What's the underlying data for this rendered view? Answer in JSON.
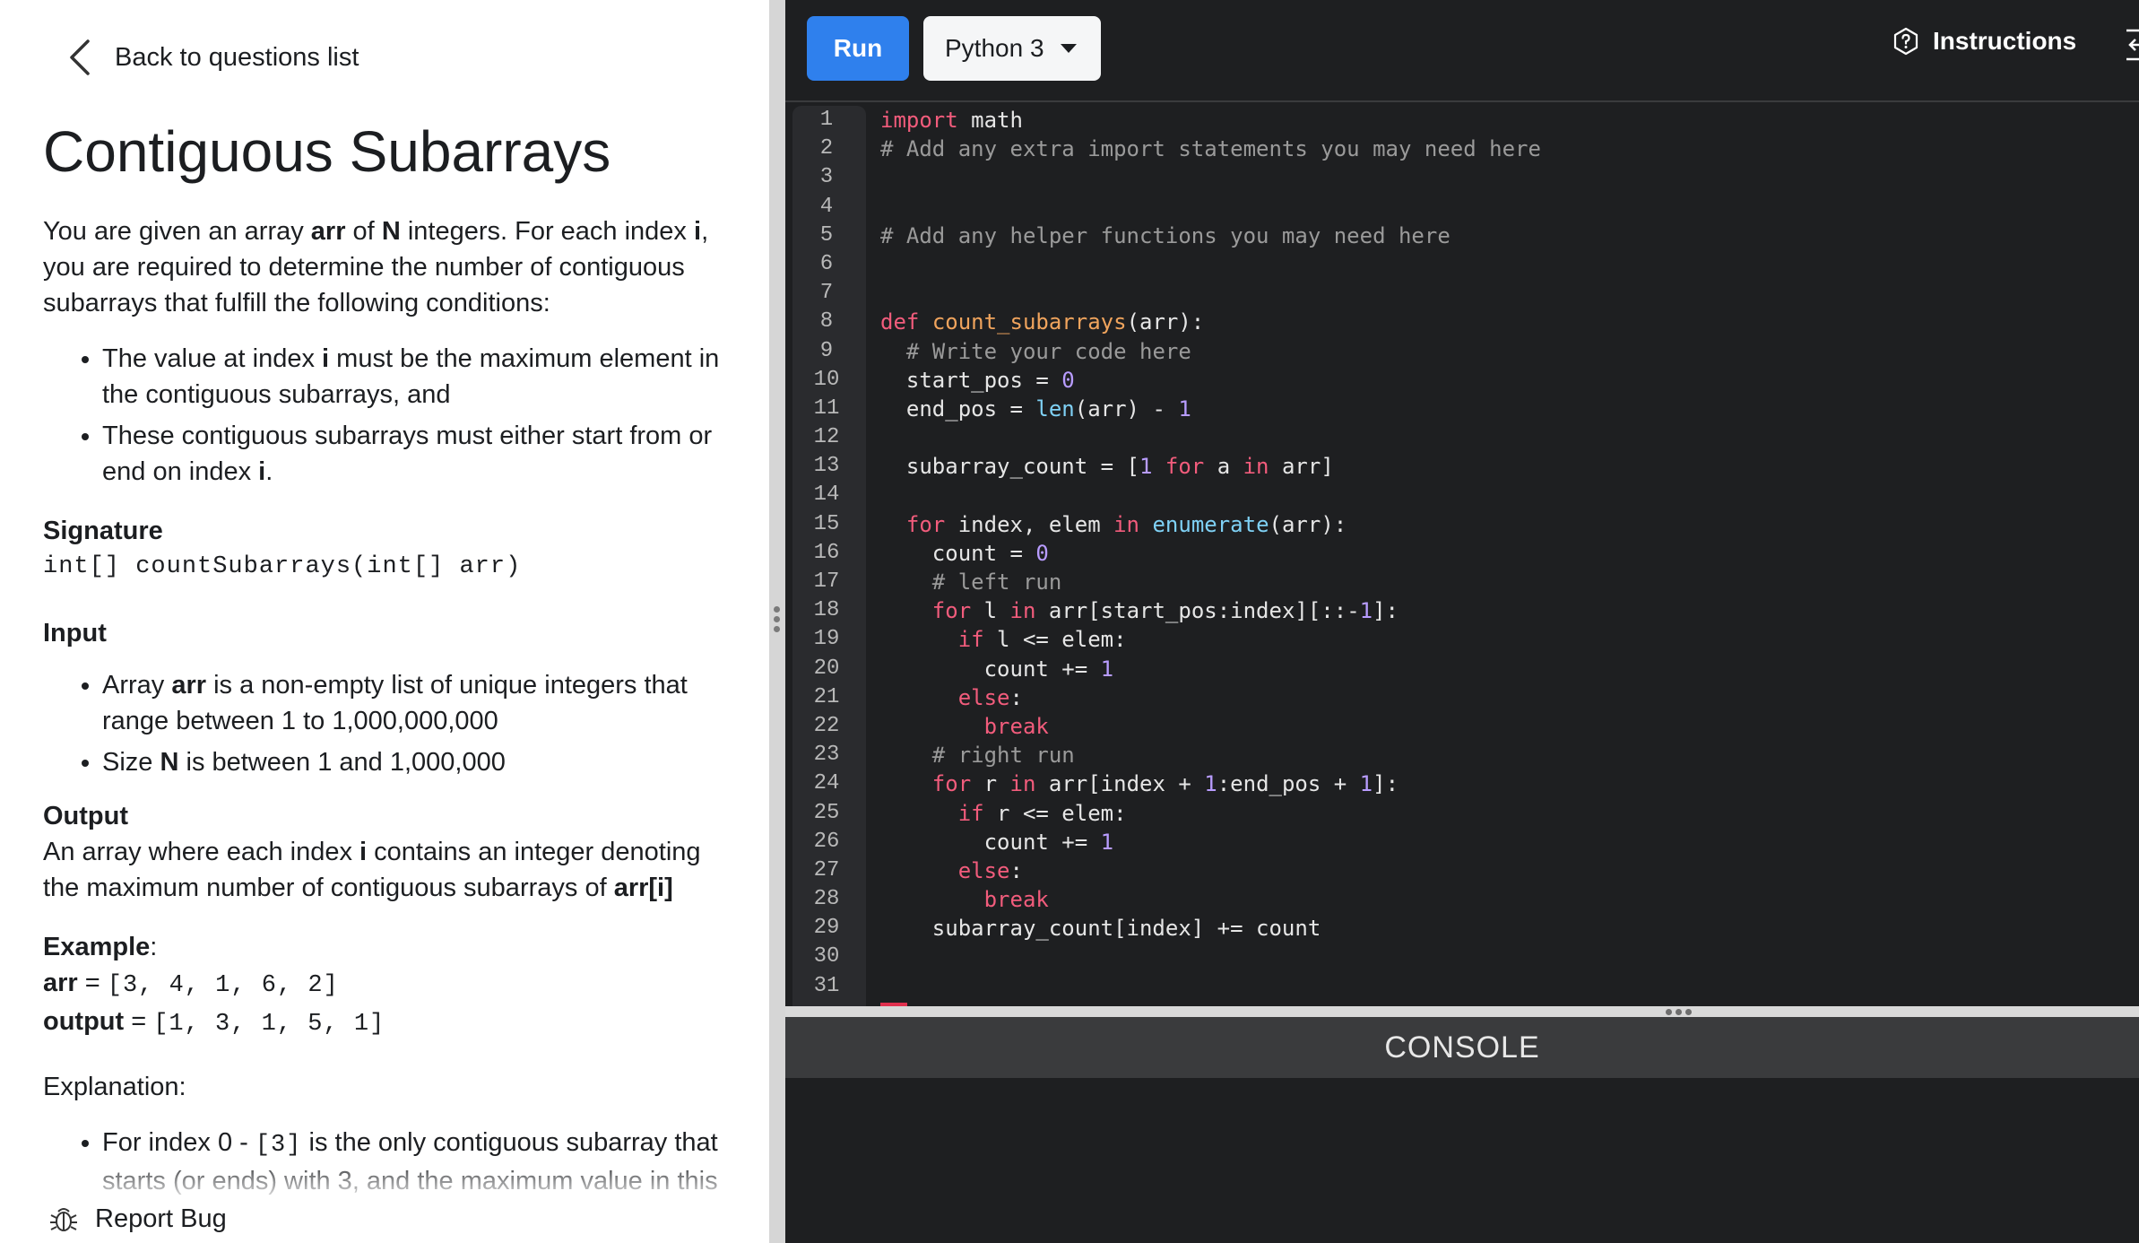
{
  "nav": {
    "back_label": "Back to questions list"
  },
  "problem": {
    "title": "Contiguous Subarrays",
    "intro": {
      "t1": "You are given an array ",
      "b1": "arr",
      "t2": " of ",
      "b2": "N",
      "t3": " integers. For each index ",
      "b3": "i",
      "t4": ", you are required to determine the number of contiguous subarrays that fulfill the following conditions:"
    },
    "conditions": [
      {
        "t1": "The value at index ",
        "b1": "i",
        "t2": " must be the maximum element in the contiguous subarrays, and"
      },
      {
        "t1": "These contiguous subarrays must either start from or end on index ",
        "b1": "i",
        "t2": "."
      }
    ],
    "signature_heading": "Signature",
    "signature": "int[] countSubarrays(int[] arr)",
    "input_heading": "Input",
    "input_items": [
      {
        "t1": "Array ",
        "b1": "arr",
        "t2": " is a non-empty list of unique integers that range between 1 to 1,000,000,000"
      },
      {
        "t1": "Size ",
        "b1": "N",
        "t2": " is between 1 and 1,000,000"
      }
    ],
    "output_heading": "Output",
    "output_text": {
      "t1": "An array where each index ",
      "b1": "i",
      "t2": " contains an integer denoting the maximum number of contiguous subarrays of ",
      "b2": "arr[i]"
    },
    "example_heading": "Example",
    "example_colon": ":",
    "example_arr_label": "arr",
    "example_arr_value": "[3, 4, 1, 6, 2]",
    "example_output_label": "output",
    "example_output_value": "[1, 3, 1, 5, 1]",
    "equals": " = ",
    "explanation_heading": "Explanation:",
    "explanation_item": {
      "t1": "For index 0 - ",
      "code": "[3]",
      "t2": " is the only contiguous subarray that starts (or ends) with 3, and the maximum value in this"
    }
  },
  "footer": {
    "report_bug": "Report Bug"
  },
  "toolbar": {
    "run_label": "Run",
    "language": "Python 3",
    "instructions_label": "Instructions"
  },
  "console": {
    "label": "CONSOLE"
  },
  "editor": {
    "line_numbers": [
      "1",
      "2",
      "3",
      "4",
      "5",
      "6",
      "7",
      "8",
      "9",
      "10",
      "11",
      "12",
      "13",
      "14",
      "15",
      "16",
      "17",
      "18",
      "19",
      "20",
      "21",
      "22",
      "23",
      "24",
      "25",
      "26",
      "27",
      "28",
      "29",
      "30",
      "31"
    ]
  },
  "colors": {
    "run_button": "#2f80ed",
    "editor_bg": "#1e1f21",
    "keyword": "#f25c7c",
    "comment": "#9a9a9a",
    "function_name": "#f0a45d",
    "builtin": "#7fd1f5",
    "number": "#b89cff"
  }
}
